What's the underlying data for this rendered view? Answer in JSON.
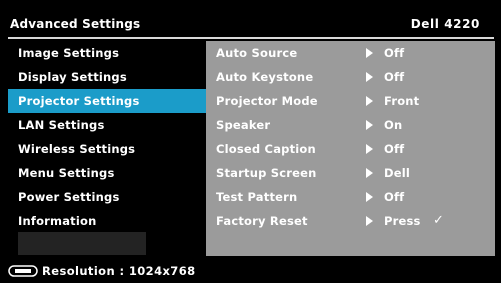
{
  "header": {
    "title": "Advanced Settings",
    "model": "Dell 4220"
  },
  "sidebar": {
    "items": [
      {
        "label": "Image Settings",
        "selected": false
      },
      {
        "label": "Display Settings",
        "selected": false
      },
      {
        "label": "Projector Settings",
        "selected": true
      },
      {
        "label": "LAN Settings",
        "selected": false
      },
      {
        "label": "Wireless Settings",
        "selected": false
      },
      {
        "label": "Menu Settings",
        "selected": false
      },
      {
        "label": "Power Settings",
        "selected": false
      },
      {
        "label": "Information",
        "selected": false
      }
    ]
  },
  "settings": [
    {
      "label": "Auto Source",
      "value": "Off"
    },
    {
      "label": "Auto Keystone",
      "value": "Off"
    },
    {
      "label": "Projector Mode",
      "value": "Front"
    },
    {
      "label": "Speaker",
      "value": "On"
    },
    {
      "label": "Closed Caption",
      "value": "Off"
    },
    {
      "label": "Startup Screen",
      "value": "Dell"
    },
    {
      "label": "Test Pattern",
      "value": "Off"
    },
    {
      "label": "Factory Reset",
      "value": "Press",
      "check": "✓"
    }
  ],
  "footer": {
    "resolution_text": "Resolution : 1024x768",
    "icon": "monitor-input-icon"
  },
  "colors": {
    "background": "#000000",
    "selected": "#1b9cc9",
    "panel": "#9b9b9b",
    "divider": "#d8d8d8"
  }
}
